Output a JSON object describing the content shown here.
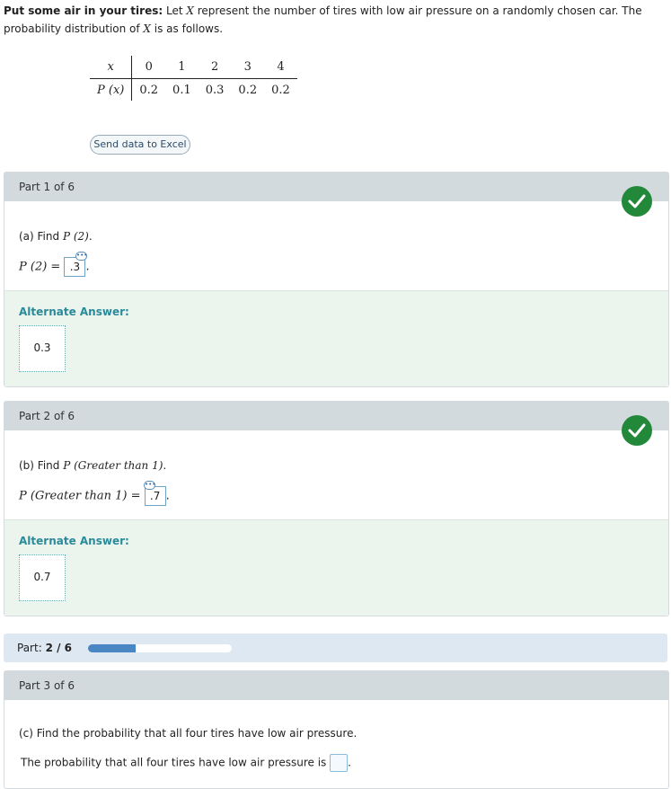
{
  "intro": {
    "title": "Put some air in your tires:",
    "text_a": " Let ",
    "var": "X",
    "text_b": " represent the number of tires with low air pressure on a randomly chosen car. The probability distribution of ",
    "var2": "X",
    "text_c": " is as follows."
  },
  "distribution": {
    "x_label": "x",
    "p_label": "P (x)",
    "x_values": [
      "0",
      "1",
      "2",
      "3",
      "4"
    ],
    "p_values": [
      "0.2",
      "0.1",
      "0.3",
      "0.2",
      "0.2"
    ]
  },
  "excel_button": "Send data to Excel",
  "parts": [
    {
      "header": "Part 1 of 6",
      "question_prefix": "(a) Find ",
      "question_math": "P (2)",
      "question_suffix": ".",
      "answer_lhs": "P (2) =",
      "answer_value": ".3",
      "alternate_label": "Alternate Answer:",
      "alternate_value": "0.3"
    },
    {
      "header": "Part 2 of 6",
      "question_prefix": "(b) Find ",
      "question_math": "P (Greater than 1)",
      "question_suffix": ".",
      "answer_lhs": "P (Greater than 1) =",
      "answer_value": ".7",
      "alternate_label": "Alternate Answer:",
      "alternate_value": "0.7"
    },
    {
      "header": "Part 3 of 6",
      "question_prefix": "(c) Find the probability that all four tires have low air pressure.",
      "answer_text": "The probability that all four tires have low air pressure is"
    }
  ],
  "progress": {
    "label": "Part:",
    "value": "2 / 6",
    "fraction": 0.333
  },
  "colors": {
    "check": "#22883a",
    "progress_fill": "#4a86c4",
    "alt_label": "#2a8a9a"
  }
}
